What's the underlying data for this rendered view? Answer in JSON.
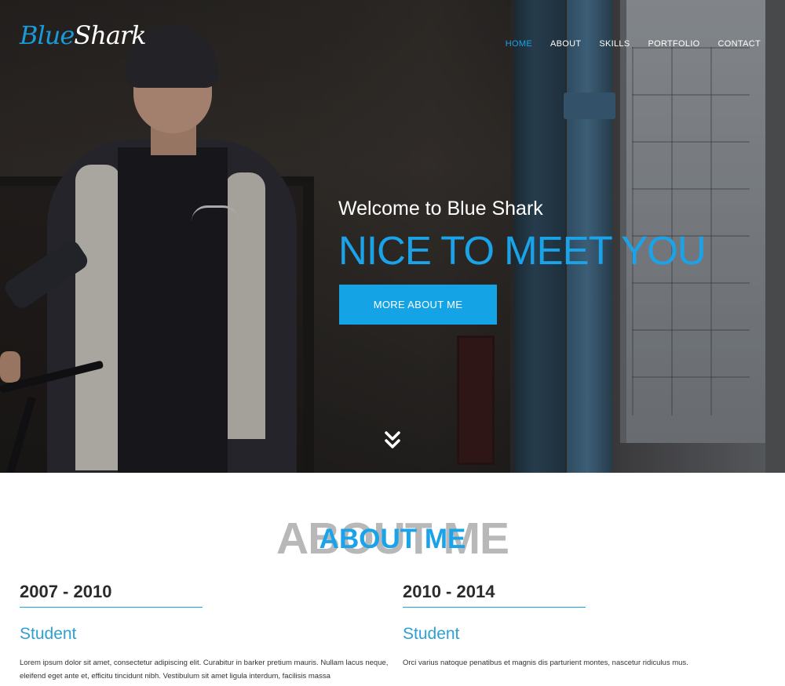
{
  "brand": {
    "part1": "Blue",
    "part2": "Shark"
  },
  "nav": {
    "items": [
      {
        "label": "HOME",
        "active": true
      },
      {
        "label": "ABOUT",
        "active": false
      },
      {
        "label": "SKILLS",
        "active": false
      },
      {
        "label": "PORTFOLIO",
        "active": false
      },
      {
        "label": "CONTACT",
        "active": false
      }
    ]
  },
  "hero": {
    "welcome": "Welcome to Blue Shark",
    "headline": "NICE TO MEET YOU",
    "cta_label": "MORE ABOUT ME",
    "scroll_icon": "double-chevron-down-icon"
  },
  "about": {
    "background_title": "ABOUT ME",
    "title": "ABOUT ME",
    "entries": [
      {
        "years": "2007 - 2010",
        "role": "Student",
        "description": "Lorem ipsum dolor sit amet, consectetur adipiscing elit. Curabitur in barker pretium mauris. Nullam lacus neque, eleifend eget ante et, efficitu tincidunt nibh. Vestibulum sit amet ligula interdum, facilisis massa"
      },
      {
        "years": "2010 - 2014",
        "role": "Student",
        "description": "Orci varius natoque penatibus et magnis dis parturient montes, nascetur ridiculus mus."
      }
    ]
  },
  "colors": {
    "accent": "#1aa3e8",
    "button": "#14a4e6",
    "heading_dark": "#2b2b2b",
    "ghost_title": "#b8b8b8"
  }
}
